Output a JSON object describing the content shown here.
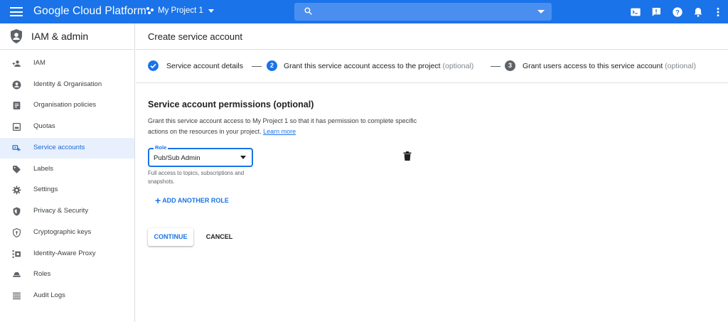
{
  "topbar": {
    "brand": "Google Cloud Platform",
    "project": "My Project 1",
    "search_placeholder": "",
    "icons": [
      "menu-icon",
      "project-icon",
      "search-icon",
      "cloud-shell-icon",
      "notification-alert-icon",
      "help-icon",
      "bell-icon",
      "more-vert-icon"
    ]
  },
  "sidebar": {
    "title": "IAM & admin",
    "items": [
      {
        "label": "IAM",
        "icon": "person-add-icon"
      },
      {
        "label": "Identity & Organisation",
        "icon": "account-circle-icon"
      },
      {
        "label": "Organisation policies",
        "icon": "policy-doc-icon"
      },
      {
        "label": "Quotas",
        "icon": "quotas-icon"
      },
      {
        "label": "Service accounts",
        "icon": "service-account-icon",
        "active": true
      },
      {
        "label": "Labels",
        "icon": "label-tag-icon"
      },
      {
        "label": "Settings",
        "icon": "gear-icon"
      },
      {
        "label": "Privacy & Security",
        "icon": "shield-icon"
      },
      {
        "label": "Cryptographic keys",
        "icon": "key-shield-icon"
      },
      {
        "label": "Identity-Aware Proxy",
        "icon": "proxy-icon"
      },
      {
        "label": "Roles",
        "icon": "roles-hat-icon"
      },
      {
        "label": "Audit Logs",
        "icon": "list-lines-icon"
      }
    ]
  },
  "main": {
    "page_title": "Create service account",
    "steps": [
      {
        "label": "Service account details",
        "optional": "",
        "state": "done",
        "number": ""
      },
      {
        "label": "Grant this service account access to the project",
        "optional": "(optional)",
        "state": "active",
        "number": "2"
      },
      {
        "label": "Grant users access to this service account",
        "optional": "(optional)",
        "state": "pending",
        "number": "3"
      }
    ],
    "section_title": "Service account permissions (optional)",
    "section_desc": "Grant this service account access to My Project 1 so that it has permission to complete specific actions on the resources in your project.",
    "learn_more": "Learn more",
    "role": {
      "label": "Role",
      "value": "Pub/Sub Admin",
      "help": "Full access to topics, subscriptions and snapshots."
    },
    "add_role": "ADD ANOTHER ROLE",
    "continue": "CONTINUE",
    "cancel": "CANCEL"
  },
  "colors": {
    "accent": "#1a73e8",
    "active_nav_bg": "#e8f0fe",
    "pending_step": "#5f6368"
  }
}
